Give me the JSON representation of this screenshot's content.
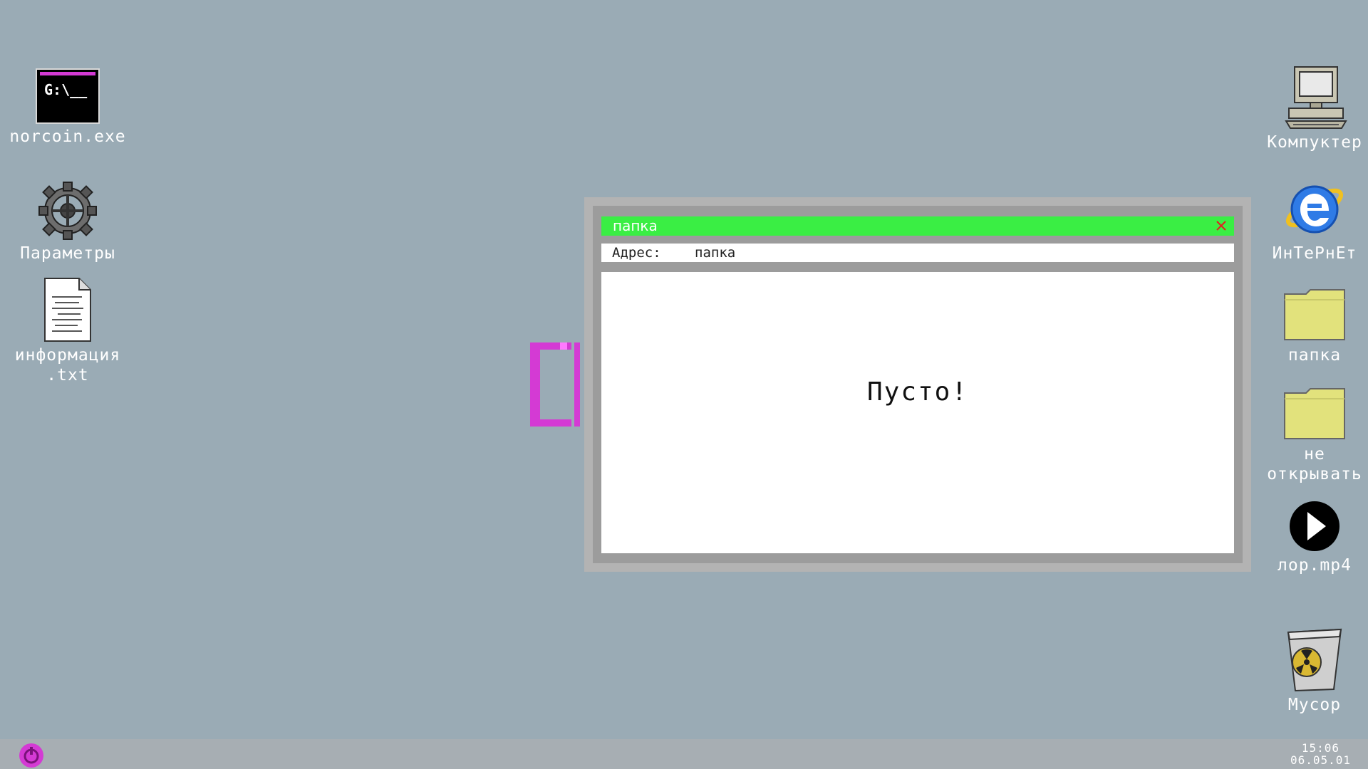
{
  "desktop": {
    "background": "#9aabb5",
    "left_icons": [
      {
        "label": "norcoin.exe",
        "icon": "terminal-icon",
        "terminal_text": "G:\\__"
      },
      {
        "label": "Параметры",
        "icon": "gear-icon"
      },
      {
        "label": "информация\n.txt",
        "icon": "text-file-icon"
      }
    ],
    "right_icons": [
      {
        "label": "Компуктер",
        "icon": "computer-icon"
      },
      {
        "label": "ИнТеРнЕт",
        "icon": "internet-explorer-icon"
      },
      {
        "label": "папка",
        "icon": "folder-icon"
      },
      {
        "label": "не\nоткрывать",
        "icon": "folder-icon"
      },
      {
        "label": "лор.mp4",
        "icon": "play-icon"
      },
      {
        "label": "Мусор",
        "icon": "trash-icon"
      }
    ]
  },
  "window": {
    "title": "папка",
    "title_color": "#3aee44",
    "address_label": "Адрес:",
    "address_value": "папка",
    "empty_message": "Пусто!"
  },
  "taskbar": {
    "power_icon": "power-icon",
    "power_color": "#d43ad4",
    "time": "15:06",
    "date": "06.05.01"
  }
}
